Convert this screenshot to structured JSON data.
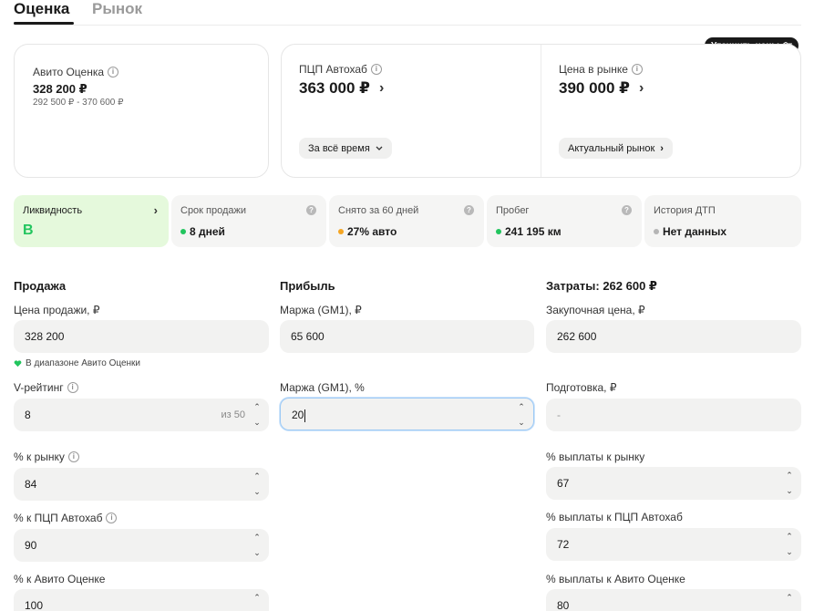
{
  "tabs": [
    {
      "label": "Оценка",
      "active": true
    },
    {
      "label": "Рынок",
      "active": false
    }
  ],
  "refine_button": {
    "label": "Уточнить цены"
  },
  "cards": {
    "avito": {
      "label": "Авито Оценка",
      "value": "328 200 ₽",
      "range": "292 500 ₽ - 370 600 ₽"
    },
    "autohub": {
      "label": "ПЦП Автохаб",
      "value": "363 000 ₽",
      "button": "За всё время"
    },
    "market": {
      "label": "Цена в рынке",
      "value": "390 000 ₽",
      "button": "Актуальный рынок"
    }
  },
  "metrics": [
    {
      "label": "Ликвидность",
      "value": "B"
    },
    {
      "label": "Срок продажи",
      "value": "8 дней",
      "dot_color": "#22c55e"
    },
    {
      "label": "Снято за 60 дней",
      "value": "27% авто",
      "dot_color": "#f5a623"
    },
    {
      "label": "Пробег",
      "value": "241 195 км",
      "dot_color": "#22c55e"
    },
    {
      "label": "История ДТП",
      "value": "Нет данных",
      "dot_color": "#b5b5b5"
    }
  ],
  "sections": {
    "sale": "Продажа",
    "profit": "Прибыль",
    "costs": "Затраты: 262 600 ₽"
  },
  "form": {
    "sale_price": {
      "label": "Цена продажи, ₽",
      "value": "328 200",
      "hint": "В диапазоне Авито Оценки"
    },
    "v_rating": {
      "label": "V-рейтинг",
      "value": "8",
      "suffix": "из 50"
    },
    "pct_market": {
      "label": "% к рынку",
      "value": "84"
    },
    "pct_autohub": {
      "label": "% к ПЦП Автохаб",
      "value": "90"
    },
    "pct_avito": {
      "label": "% к Авито Оценке",
      "value": "100"
    },
    "margin_rub": {
      "label": "Маржа (GM1), ₽",
      "value": "65 600"
    },
    "margin_pct": {
      "label": "Маржа (GM1), %",
      "value": "20"
    },
    "purchase_price": {
      "label": "Закупочная цена, ₽",
      "value": "262 600"
    },
    "preparation": {
      "label": "Подготовка, ₽",
      "placeholder": "-"
    },
    "payout_market": {
      "label": "% выплаты к рынку",
      "value": "67"
    },
    "payout_autohub": {
      "label": "% выплаты к ПЦП Автохаб",
      "value": "72"
    },
    "payout_avito": {
      "label": "% выплаты к Авито Оценке",
      "value": "80"
    }
  },
  "icons": {
    "info": "info-icon",
    "chevron_right": "chevron-right-icon",
    "chevron_down": "chevron-down-icon",
    "question": "question-icon",
    "sliders": "sliders-icon",
    "heart": "heart-icon"
  },
  "colors": {
    "accent_green": "#22c55e",
    "liquidity_bg": "#e5f9dc",
    "focus_border": "#9cc9f5"
  }
}
